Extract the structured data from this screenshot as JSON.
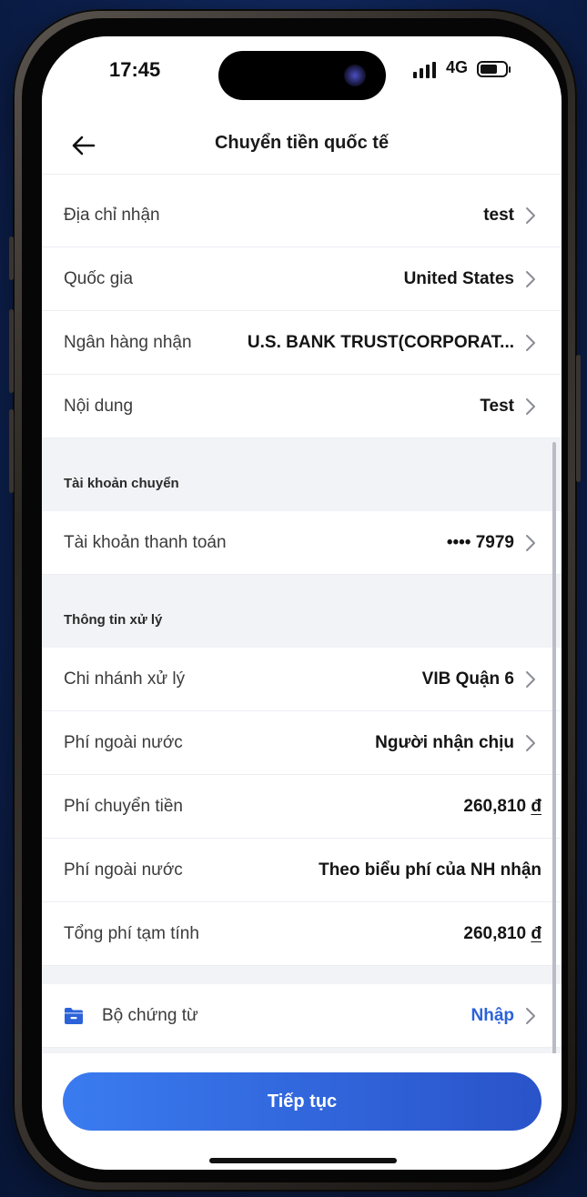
{
  "status_bar": {
    "time": "17:45",
    "network": "4G"
  },
  "header": {
    "title": "Chuyển tiền quốc tế",
    "back_icon": "arrow-left-icon"
  },
  "recipient_rows": [
    {
      "label": "Địa chỉ nhận",
      "value": "test"
    },
    {
      "label": "Quốc gia",
      "value": "United States"
    },
    {
      "label": "Ngân hàng nhận",
      "value": "U.S. BANK TRUST(CORPORAT..."
    },
    {
      "label": "Nội dung",
      "value": "Test"
    }
  ],
  "source_section": {
    "title": "Tài khoản chuyển",
    "row": {
      "label": "Tài khoản thanh toán",
      "value": "•••• 7979"
    }
  },
  "processing_section": {
    "title": "Thông tin xử lý",
    "rows": [
      {
        "label": "Chi nhánh xử lý",
        "value": "VIB Quận 6"
      },
      {
        "label": "Phí ngoài nước",
        "value": "Người nhận chịu"
      },
      {
        "label": "Phí chuyển tiền",
        "value": "260,810",
        "currency": "đ"
      },
      {
        "label": "Phí ngoài nước",
        "value": "Theo biểu phí của NH nhận"
      },
      {
        "label": "Tổng phí tạm tính",
        "value": "260,810",
        "currency": "đ"
      }
    ]
  },
  "documents": {
    "label": "Bộ chứng từ",
    "action": "Nhập",
    "icon": "folder-icon"
  },
  "footer": {
    "continue_label": "Tiếp tục"
  },
  "colors": {
    "accent": "#2b62d9",
    "button_start": "#3a7bf0",
    "button_end": "#2a53c9",
    "background": "#0f2558"
  }
}
